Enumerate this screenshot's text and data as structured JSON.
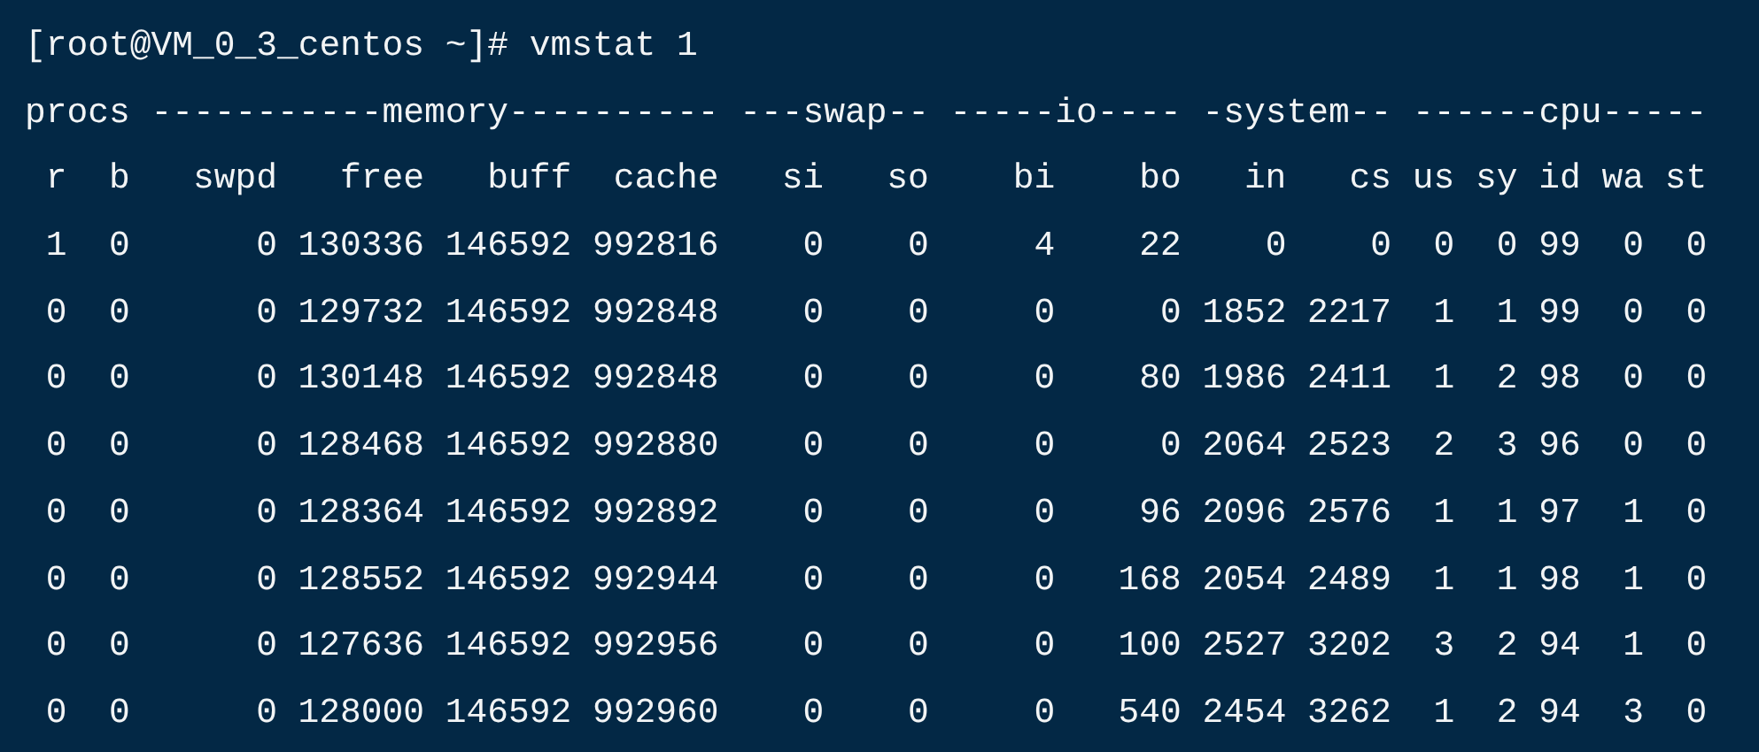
{
  "prompt": "[root@VM_0_3_centos ~]# vmstat 1",
  "group_header": "procs -----------memory---------- ---swap-- -----io---- -system-- ------cpu-----",
  "columns": [
    "r",
    "b",
    "swpd",
    "free",
    "buff",
    "cache",
    "si",
    "so",
    "bi",
    "bo",
    "in",
    "cs",
    "us",
    "sy",
    "id",
    "wa",
    "st"
  ],
  "rows": [
    [
      "1",
      "0",
      "0",
      "130336",
      "146592",
      "992816",
      "0",
      "0",
      "4",
      "22",
      "0",
      "0",
      "0",
      "0",
      "99",
      "0",
      "0"
    ],
    [
      "0",
      "0",
      "0",
      "129732",
      "146592",
      "992848",
      "0",
      "0",
      "0",
      "0",
      "1852",
      "2217",
      "1",
      "1",
      "99",
      "0",
      "0"
    ],
    [
      "0",
      "0",
      "0",
      "130148",
      "146592",
      "992848",
      "0",
      "0",
      "0",
      "80",
      "1986",
      "2411",
      "1",
      "2",
      "98",
      "0",
      "0"
    ],
    [
      "0",
      "0",
      "0",
      "128468",
      "146592",
      "992880",
      "0",
      "0",
      "0",
      "0",
      "2064",
      "2523",
      "2",
      "3",
      "96",
      "0",
      "0"
    ],
    [
      "0",
      "0",
      "0",
      "128364",
      "146592",
      "992892",
      "0",
      "0",
      "0",
      "96",
      "2096",
      "2576",
      "1",
      "1",
      "97",
      "1",
      "0"
    ],
    [
      "0",
      "0",
      "0",
      "128552",
      "146592",
      "992944",
      "0",
      "0",
      "0",
      "168",
      "2054",
      "2489",
      "1",
      "1",
      "98",
      "1",
      "0"
    ],
    [
      "0",
      "0",
      "0",
      "127636",
      "146592",
      "992956",
      "0",
      "0",
      "0",
      "100",
      "2527",
      "3202",
      "3",
      "2",
      "94",
      "1",
      "0"
    ],
    [
      "0",
      "0",
      "0",
      "128000",
      "146592",
      "992960",
      "0",
      "0",
      "0",
      "540",
      "2454",
      "3262",
      "1",
      "2",
      "94",
      "3",
      "0"
    ]
  ]
}
